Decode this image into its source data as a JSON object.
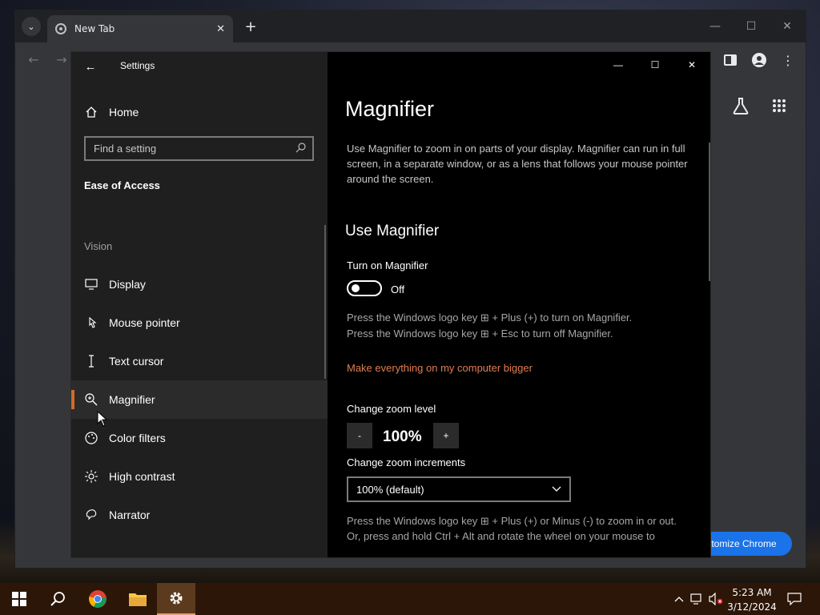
{
  "chrome": {
    "tab_title": "New Tab",
    "tab_close": "✕",
    "new_tab": "+",
    "tab_search": "⌄",
    "customize_label": "tomize Chrome"
  },
  "settings": {
    "window_title": "Settings",
    "home_label": "Home",
    "search_placeholder": "Find a setting",
    "section_heading": "Ease of Access",
    "group_label": "Vision",
    "nav_items": [
      {
        "label": "Display",
        "icon": "display-icon"
      },
      {
        "label": "Mouse pointer",
        "icon": "mouse-pointer-icon"
      },
      {
        "label": "Text cursor",
        "icon": "text-cursor-icon"
      },
      {
        "label": "Magnifier",
        "icon": "magnifier-icon",
        "selected": true
      },
      {
        "label": "Color filters",
        "icon": "color-filters-icon"
      },
      {
        "label": "High contrast",
        "icon": "high-contrast-icon"
      },
      {
        "label": "Narrator",
        "icon": "narrator-icon"
      }
    ],
    "page_title": "Magnifier",
    "description": "Use Magnifier to zoom in on parts of your display. Magnifier can run in full screen, in a separate window, or as a lens that follows your mouse pointer around the screen.",
    "use_heading": "Use Magnifier",
    "toggle_label": "Turn on Magnifier",
    "toggle_state": "Off",
    "hint_on": "Press the Windows logo key ⊞ + Plus (+) to turn on Magnifier.",
    "hint_off": "Press the Windows logo key ⊞ + Esc to turn off Magnifier.",
    "link_bigger": "Make everything on my computer bigger",
    "zoom_label": "Change zoom level",
    "zoom_minus": "-",
    "zoom_value": "100%",
    "zoom_plus": "+",
    "increments_label": "Change zoom increments",
    "increments_value": "100% (default)",
    "hint_zoom": "Press the Windows logo key ⊞ + Plus (+) or Minus (-) to zoom in or out.",
    "hint_wheel": "Or, press and hold Ctrl + Alt and rotate the wheel on your mouse to"
  },
  "taskbar": {
    "time": "5:23 AM",
    "date": "3/12/2024"
  },
  "colors": {
    "accent": "#d26c2a",
    "link": "#e07d50",
    "taskbar": "#2b1608"
  }
}
